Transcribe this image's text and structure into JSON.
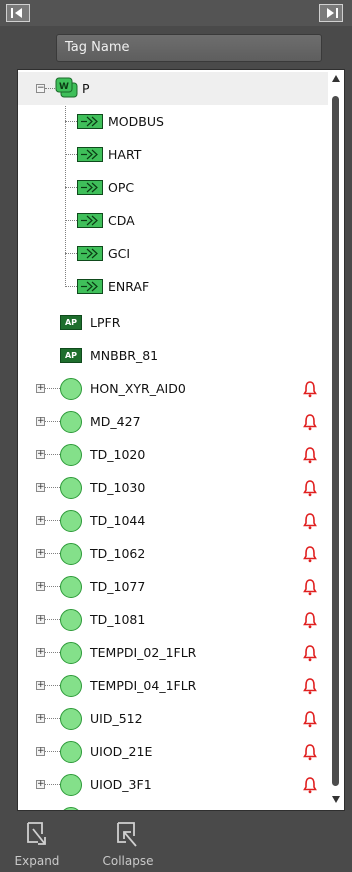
{
  "nav": {
    "first_icon": "first-page-icon",
    "last_icon": "last-page-icon"
  },
  "search": {
    "label": "Tag Name"
  },
  "tree": {
    "root": {
      "label": "P",
      "icon": "workstation-icon",
      "expander": "−"
    },
    "children": [
      {
        "label": "MODBUS"
      },
      {
        "label": "HART"
      },
      {
        "label": "OPC"
      },
      {
        "label": "CDA"
      },
      {
        "label": "GCI"
      },
      {
        "label": "ENRAF"
      }
    ],
    "ap_badge": "AP",
    "ap_items": [
      {
        "label": "LPFR"
      },
      {
        "label": "MNBBR_81"
      }
    ],
    "assets": [
      {
        "label": "HON_XYR_AID0"
      },
      {
        "label": "MD_427"
      },
      {
        "label": "TD_1020"
      },
      {
        "label": "TD_1030"
      },
      {
        "label": "TD_1044"
      },
      {
        "label": "TD_1062"
      },
      {
        "label": "TD_1077"
      },
      {
        "label": "TD_1081"
      },
      {
        "label": "TEMPDI_02_1FLR"
      },
      {
        "label": "TEMPDI_04_1FLR"
      },
      {
        "label": "UID_512"
      },
      {
        "label": "UIOD_21E"
      },
      {
        "label": "UIOD_3F1"
      }
    ],
    "asset_expander": "+"
  },
  "colors": {
    "alarm": "#e02020",
    "status_green": "#84e08a",
    "channel_green": "#3fbf5a"
  },
  "footer": {
    "expand_label": "Expand",
    "collapse_label": "Collapse"
  }
}
